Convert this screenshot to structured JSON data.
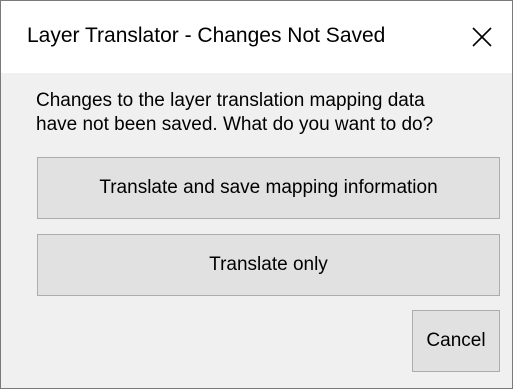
{
  "dialog": {
    "title": "Layer Translator - Changes Not Saved",
    "close_icon": "close-icon",
    "message_line1": "Changes to the layer translation mapping data",
    "message_line2": "have not been saved. What do you want to do?",
    "buttons": {
      "translate_and_save": "Translate and save mapping information",
      "translate_only": "Translate only",
      "cancel": "Cancel"
    }
  },
  "colors": {
    "titlebar_bg": "#ffffff",
    "body_bg": "#f0f0f0",
    "button_bg": "#e1e1e1",
    "button_border": "#adadad"
  }
}
